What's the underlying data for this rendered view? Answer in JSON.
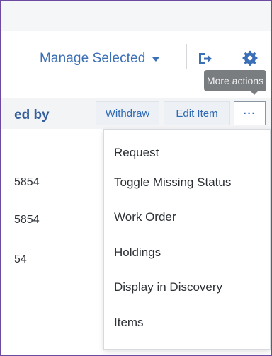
{
  "header": {
    "manage_selected_label": "Manage Selected",
    "export_icon": "export-icon",
    "settings_icon": "gear-icon"
  },
  "tooltip": {
    "text": "More actions"
  },
  "table": {
    "column_header": "ed by",
    "rows": [
      "5854",
      "5854",
      "54"
    ]
  },
  "row_actions": {
    "withdraw_label": "Withdraw",
    "edit_label": "Edit Item",
    "more_label": "···"
  },
  "menu": {
    "items": [
      "Request",
      "Toggle Missing Status",
      "Work Order",
      "Holdings",
      "Display in Discovery",
      "Items"
    ]
  },
  "colors": {
    "link_blue": "#3b6fb6",
    "header_blue": "#355f9c",
    "frame_border": "#6b4aa0",
    "tooltip_bg": "#7a7d80"
  }
}
